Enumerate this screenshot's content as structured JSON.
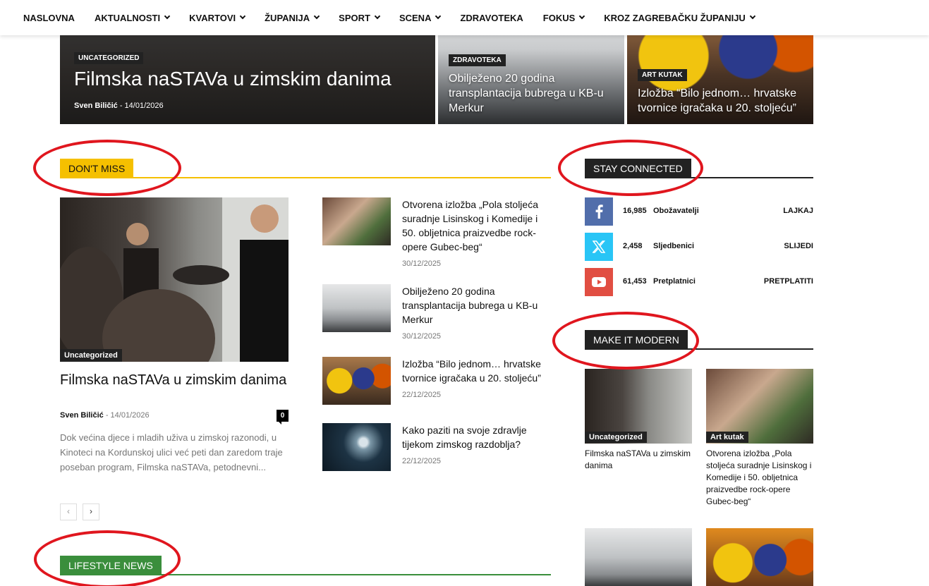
{
  "nav": {
    "items": [
      {
        "label": "NASLOVNA",
        "dropdown": false
      },
      {
        "label": "AKTUALNOSTI",
        "dropdown": true
      },
      {
        "label": "KVARTOVI",
        "dropdown": true
      },
      {
        "label": "ŽUPANIJA",
        "dropdown": true
      },
      {
        "label": "SPORT",
        "dropdown": true
      },
      {
        "label": "SCENA",
        "dropdown": true
      },
      {
        "label": "ZDRAVOTEKA",
        "dropdown": false
      },
      {
        "label": "FOKUS",
        "dropdown": true
      },
      {
        "label": "KROZ ZAGREBAČKU ŽUPANIJU",
        "dropdown": true
      }
    ]
  },
  "hero": {
    "main": {
      "category": "UNCATEGORIZED",
      "title": "Filmska naSTAVa u zimskim danima",
      "author": "Sven Biličić",
      "sep": " - ",
      "date": "14/01/2026"
    },
    "second": {
      "category": "ZDRAVOTEKA",
      "title": "Obilježeno 20 godina transplantacija bubrega u KB-u Merkur"
    },
    "third": {
      "category": "ART KUTAK",
      "title": "Izložba “Bilo jednom… hrvatske tvornice igračaka u 20. stoljeću”"
    }
  },
  "dont_miss": {
    "header": "DON'T MISS",
    "accent": "#f5c000",
    "featured": {
      "category": "Uncategorized",
      "title": "Filmska naSTAVa u zimskim danima",
      "author": "Sven Biličić",
      "sep": " - ",
      "date": "14/01/2026",
      "comments": "0",
      "excerpt": "Dok većina djece i mladih uživa u zimskoj razonodi, u Kinoteci na Kordunskoj ulici već peti dan zaredom traje poseban program, Filmska naSTAVa, petodnevni..."
    },
    "pager": {
      "prev": "‹",
      "next": "›"
    },
    "list": [
      {
        "title": "Otvorena izložba „Pola stoljeća suradnje Lisinskog i Komedije i 50. obljetnica praizvedbe rock-opere Gubec-beg“",
        "date": "30/12/2025"
      },
      {
        "title": "Obilježeno 20 godina transplantacija bubrega u KB-u Merkur",
        "date": "30/12/2025"
      },
      {
        "title": "Izložba “Bilo jednom… hrvatske tvornice igračaka u 20. stoljeću”",
        "date": "22/12/2025"
      },
      {
        "title": "Kako paziti na svoje zdravlje tijekom zimskog razdoblja?",
        "date": "22/12/2025"
      }
    ]
  },
  "stay_connected": {
    "header": "STAY CONNECTED",
    "items": [
      {
        "icon": "facebook-icon",
        "color": "#516eab",
        "count": "16,985",
        "name": "Obožavatelji",
        "action": "LAJKAJ"
      },
      {
        "icon": "x-icon",
        "color": "#29c5f6",
        "count": "2,458",
        "name": "Sljedbenici",
        "action": "SLIJEDI"
      },
      {
        "icon": "youtube-icon",
        "color": "#e14e42",
        "count": "61,453",
        "name": "Pretplatnici",
        "action": "PRETPLATITI"
      }
    ]
  },
  "make_it_modern": {
    "header": "MAKE IT MODERN",
    "items": [
      {
        "category": "Uncategorized",
        "title": "Filmska naSTAVa u zimskim danima"
      },
      {
        "category": "Art kutak",
        "title": "Otvorena izložba „Pola stoljeća suradnje Lisinskog i Komedije i 50. obljetnica praizvedbe rock-opere Gubec-beg“"
      }
    ]
  },
  "lifestyle": {
    "header": "LIFESTYLE NEWS",
    "accent": "#3a8e3c"
  }
}
